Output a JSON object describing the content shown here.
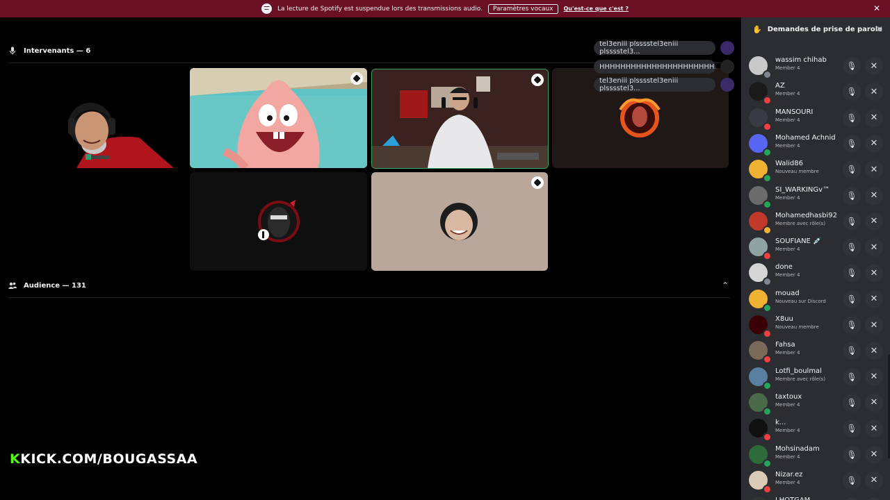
{
  "banner": {
    "message": "La lecture de Spotify est suspendue lors des transmissions audio.",
    "button": "Paramètres vocaux",
    "link": "Qu'est-ce que c'est ?",
    "close": "✕"
  },
  "speakers": {
    "title": "Intervenants — 6"
  },
  "audience": {
    "title": "Audience — 131",
    "chevron": "⌃"
  },
  "chat": [
    "tel3eniii plsssstel3eniii plsssstel3...",
    "HHHHHHHHHHHHHHHHHHHHHH...",
    "tel3eniii plsssstel3eniii plsssstel3..."
  ],
  "overlay": {
    "prefix": "K",
    "text": "KICK.COM/BOUGASSAA"
  },
  "panel": {
    "title": "Demandes de prise de parole",
    "close": "✕",
    "mic_glyph": "🎙",
    "x_glyph": "✕",
    "requests": [
      {
        "name": "wassim chihab",
        "role": "Member 4",
        "avatar": "#c9c9c9",
        "status": "#80848e"
      },
      {
        "name": "AZ",
        "role": "Member 4",
        "avatar": "#1a1a1a",
        "status": "#f23f43"
      },
      {
        "name": "MANSOURI",
        "role": "Member 4",
        "avatar": "#3a3a44",
        "status": "#f23f43"
      },
      {
        "name": "Mohamed Achnid",
        "role": "Member 4",
        "avatar": "#5865f2",
        "status": "#23a55a"
      },
      {
        "name": "Walid86",
        "role": "Nouveau membre",
        "avatar": "#f0b232",
        "status": "#23a55a"
      },
      {
        "name": "SI_WARKINGv™",
        "role": "Member 4",
        "avatar": "#6b6b6b",
        "status": "#23a55a"
      },
      {
        "name": "Mohamedhasbi92",
        "role": "Membre avec rôle(s)",
        "avatar": "#c0392b",
        "status": "#f0b232"
      },
      {
        "name": "SOUFIANE 💉",
        "role": "Member 4",
        "avatar": "#8fa3a0",
        "status": "#f23f43"
      },
      {
        "name": "done",
        "role": "Member 4",
        "avatar": "#d5d5d5",
        "status": "#80848e"
      },
      {
        "name": "mouad",
        "role": "Nouveau sur Discord",
        "avatar": "#f0b232",
        "status": "#23a55a"
      },
      {
        "name": "X8uu",
        "role": "Nouveau membre",
        "avatar": "#3a0008",
        "status": "#f23f43"
      },
      {
        "name": "Fahsa",
        "role": "Member 4",
        "avatar": "#7a6a5a",
        "status": "#f23f43"
      },
      {
        "name": "Lotfi_boulmal",
        "role": "Membre avec rôle(s)",
        "avatar": "#5a7fa0",
        "status": "#23a55a"
      },
      {
        "name": "taxtoux",
        "role": "Member 4",
        "avatar": "#4a6a4a",
        "status": "#23a55a"
      },
      {
        "name": "k...",
        "role": "Member 4",
        "avatar": "#111111",
        "status": "#f23f43"
      },
      {
        "name": "Mohsinadam",
        "role": "Member 4",
        "avatar": "#2e6b3a",
        "status": "#23a55a"
      },
      {
        "name": "Nizar.ez",
        "role": "Member 4",
        "avatar": "#d9cbb8",
        "status": "#f23f43"
      },
      {
        "name": "LHOTGAM",
        "role": "",
        "avatar": "#333333",
        "status": "#80848e"
      }
    ]
  }
}
